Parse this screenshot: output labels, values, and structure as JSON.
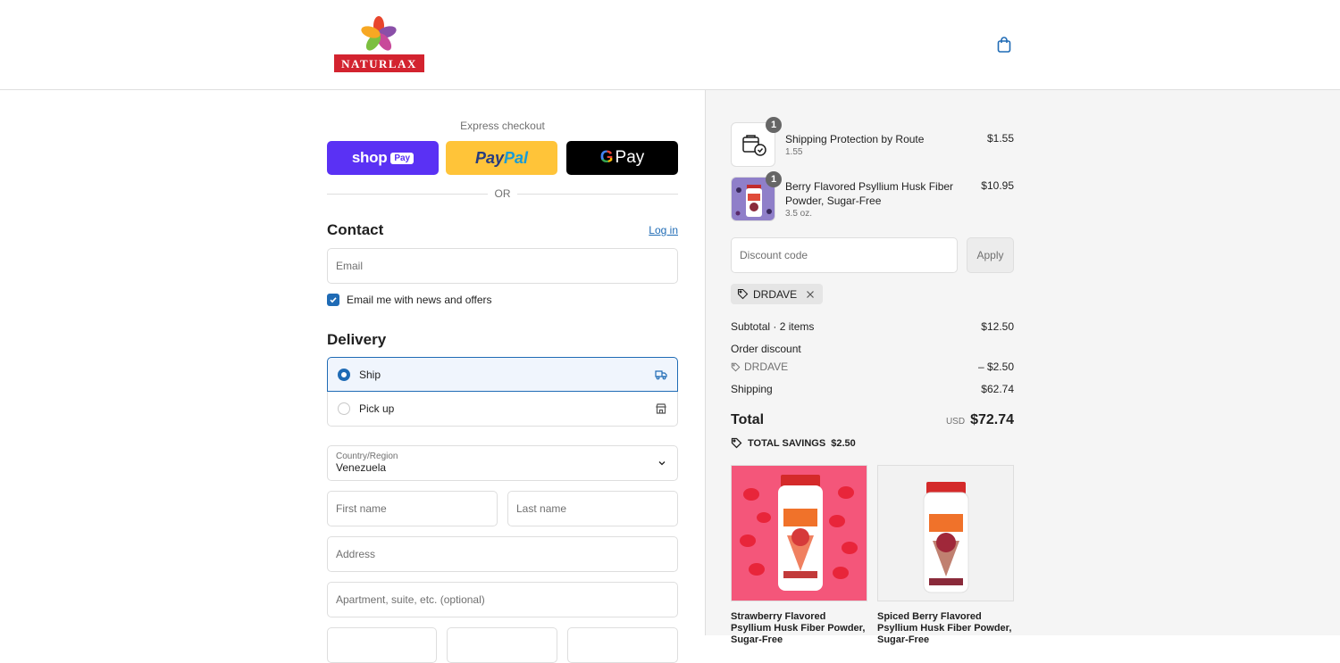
{
  "brand": {
    "logo_text": "NATURLAX"
  },
  "express": {
    "title": "Express checkout",
    "shop_pay_word": "shop",
    "shop_pay_chip": "Pay",
    "paypal_pay": "Pay",
    "paypal_pal": "Pal",
    "gpay_g": "G",
    "gpay_word": "Pay",
    "or": "OR"
  },
  "contact": {
    "heading": "Contact",
    "login": "Log in",
    "email_placeholder": "Email",
    "newsletter_label": "Email me with news and offers",
    "newsletter_checked": true
  },
  "delivery": {
    "heading": "Delivery",
    "options": [
      {
        "label": "Ship",
        "selected": true,
        "icon": "truck-icon"
      },
      {
        "label": "Pick up",
        "selected": false,
        "icon": "store-icon"
      }
    ],
    "country_label": "Country/Region",
    "country_value": "Venezuela",
    "first_name_placeholder": "First name",
    "last_name_placeholder": "Last name",
    "address_placeholder": "Address",
    "apartment_placeholder": "Apartment, suite, etc. (optional)"
  },
  "order": {
    "items": [
      {
        "name": "Shipping Protection by Route",
        "sub": "1.55",
        "price": "$1.55",
        "qty": "1"
      },
      {
        "name": "Berry Flavored Psyllium Husk Fiber Powder, Sugar-Free",
        "sub": "3.5 oz.",
        "price": "$10.95",
        "qty": "1"
      }
    ],
    "discount_placeholder": "Discount code",
    "apply_label": "Apply",
    "applied_code": "DRDAVE",
    "subtotal_label": "Subtotal · 2 items",
    "subtotal_value": "$12.50",
    "order_discount_label": "Order discount",
    "discount_code": "DRDAVE",
    "discount_value": "– $2.50",
    "shipping_label": "Shipping",
    "shipping_value": "$62.74",
    "total_label": "Total",
    "currency": "USD",
    "total_value": "$72.74",
    "savings_label": "TOTAL SAVINGS",
    "savings_value": "$2.50"
  },
  "recommendations": [
    {
      "name": "Strawberry Flavored Psyllium Husk Fiber Powder, Sugar-Free",
      "bg": "#f4567a"
    },
    {
      "name": "Spiced Berry Flavored Psyllium Husk Fiber Powder, Sugar-Free",
      "bg": "#f2f2f2"
    }
  ],
  "colors": {
    "accent": "#1f6bb5",
    "shop_pay": "#5a31f4",
    "paypal": "#ffc439"
  }
}
